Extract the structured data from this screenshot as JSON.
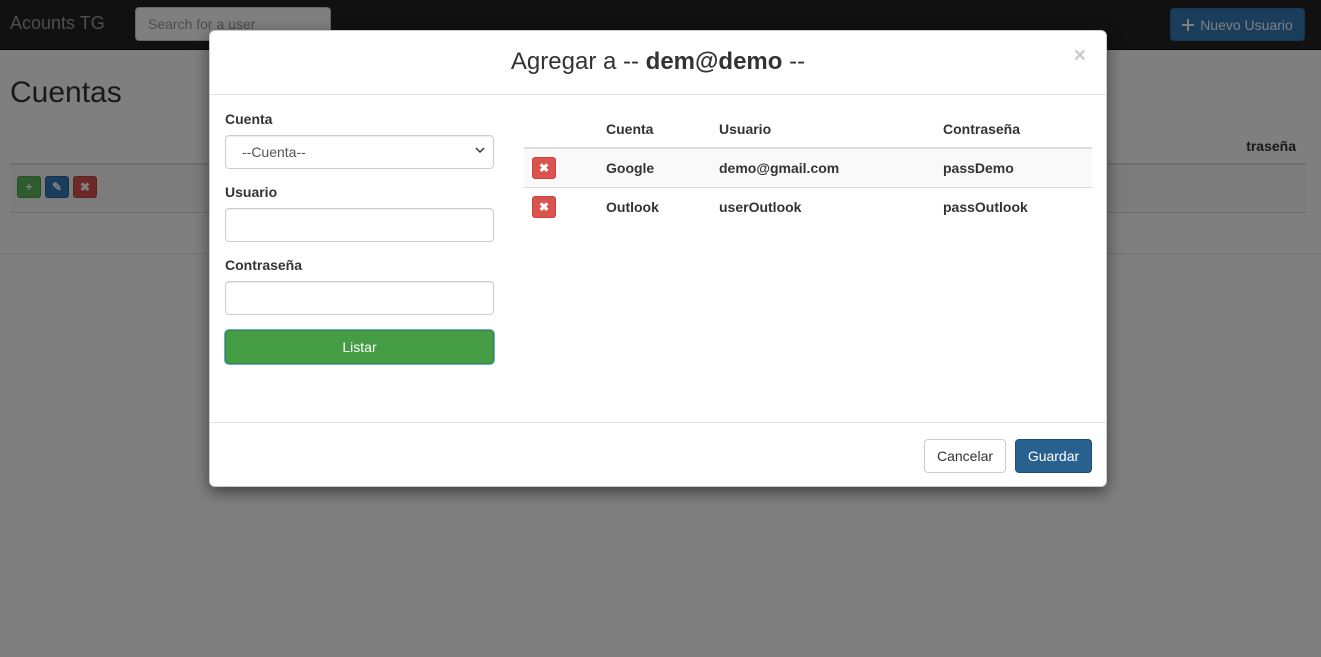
{
  "navbar": {
    "brand": "Acounts TG",
    "search_placeholder": "Search for a user",
    "new_user_label": "Nuevo Usuario"
  },
  "page": {
    "title": "Cuentas",
    "table_visible_header": "traseña"
  },
  "modal": {
    "title_prefix": "Agregar a",
    "title_sep_left": "--",
    "title_user": "dem@demo",
    "title_sep_right": "--",
    "close_symbol": "×",
    "form": {
      "cuenta_label": "Cuenta",
      "cuenta_selected": "--Cuenta--",
      "usuario_label": "Usuario",
      "usuario_value": "",
      "password_label": "Contraseña",
      "password_value": "",
      "listar_label": "Listar"
    },
    "table": {
      "headers": [
        "",
        "Cuenta",
        "Usuario",
        "Contraseña"
      ],
      "rows": [
        {
          "cuenta": "Google",
          "usuario": "demo@gmail.com",
          "password": "passDemo"
        },
        {
          "cuenta": "Outlook",
          "usuario": "userOutlook",
          "password": "passOutlook"
        }
      ]
    },
    "footer": {
      "cancel_label": "Cancelar",
      "save_label": "Guardar"
    }
  },
  "colors": {
    "navbar_bg": "#222222",
    "primary": "#337ab7",
    "success": "#449d44",
    "danger": "#d9534f"
  }
}
